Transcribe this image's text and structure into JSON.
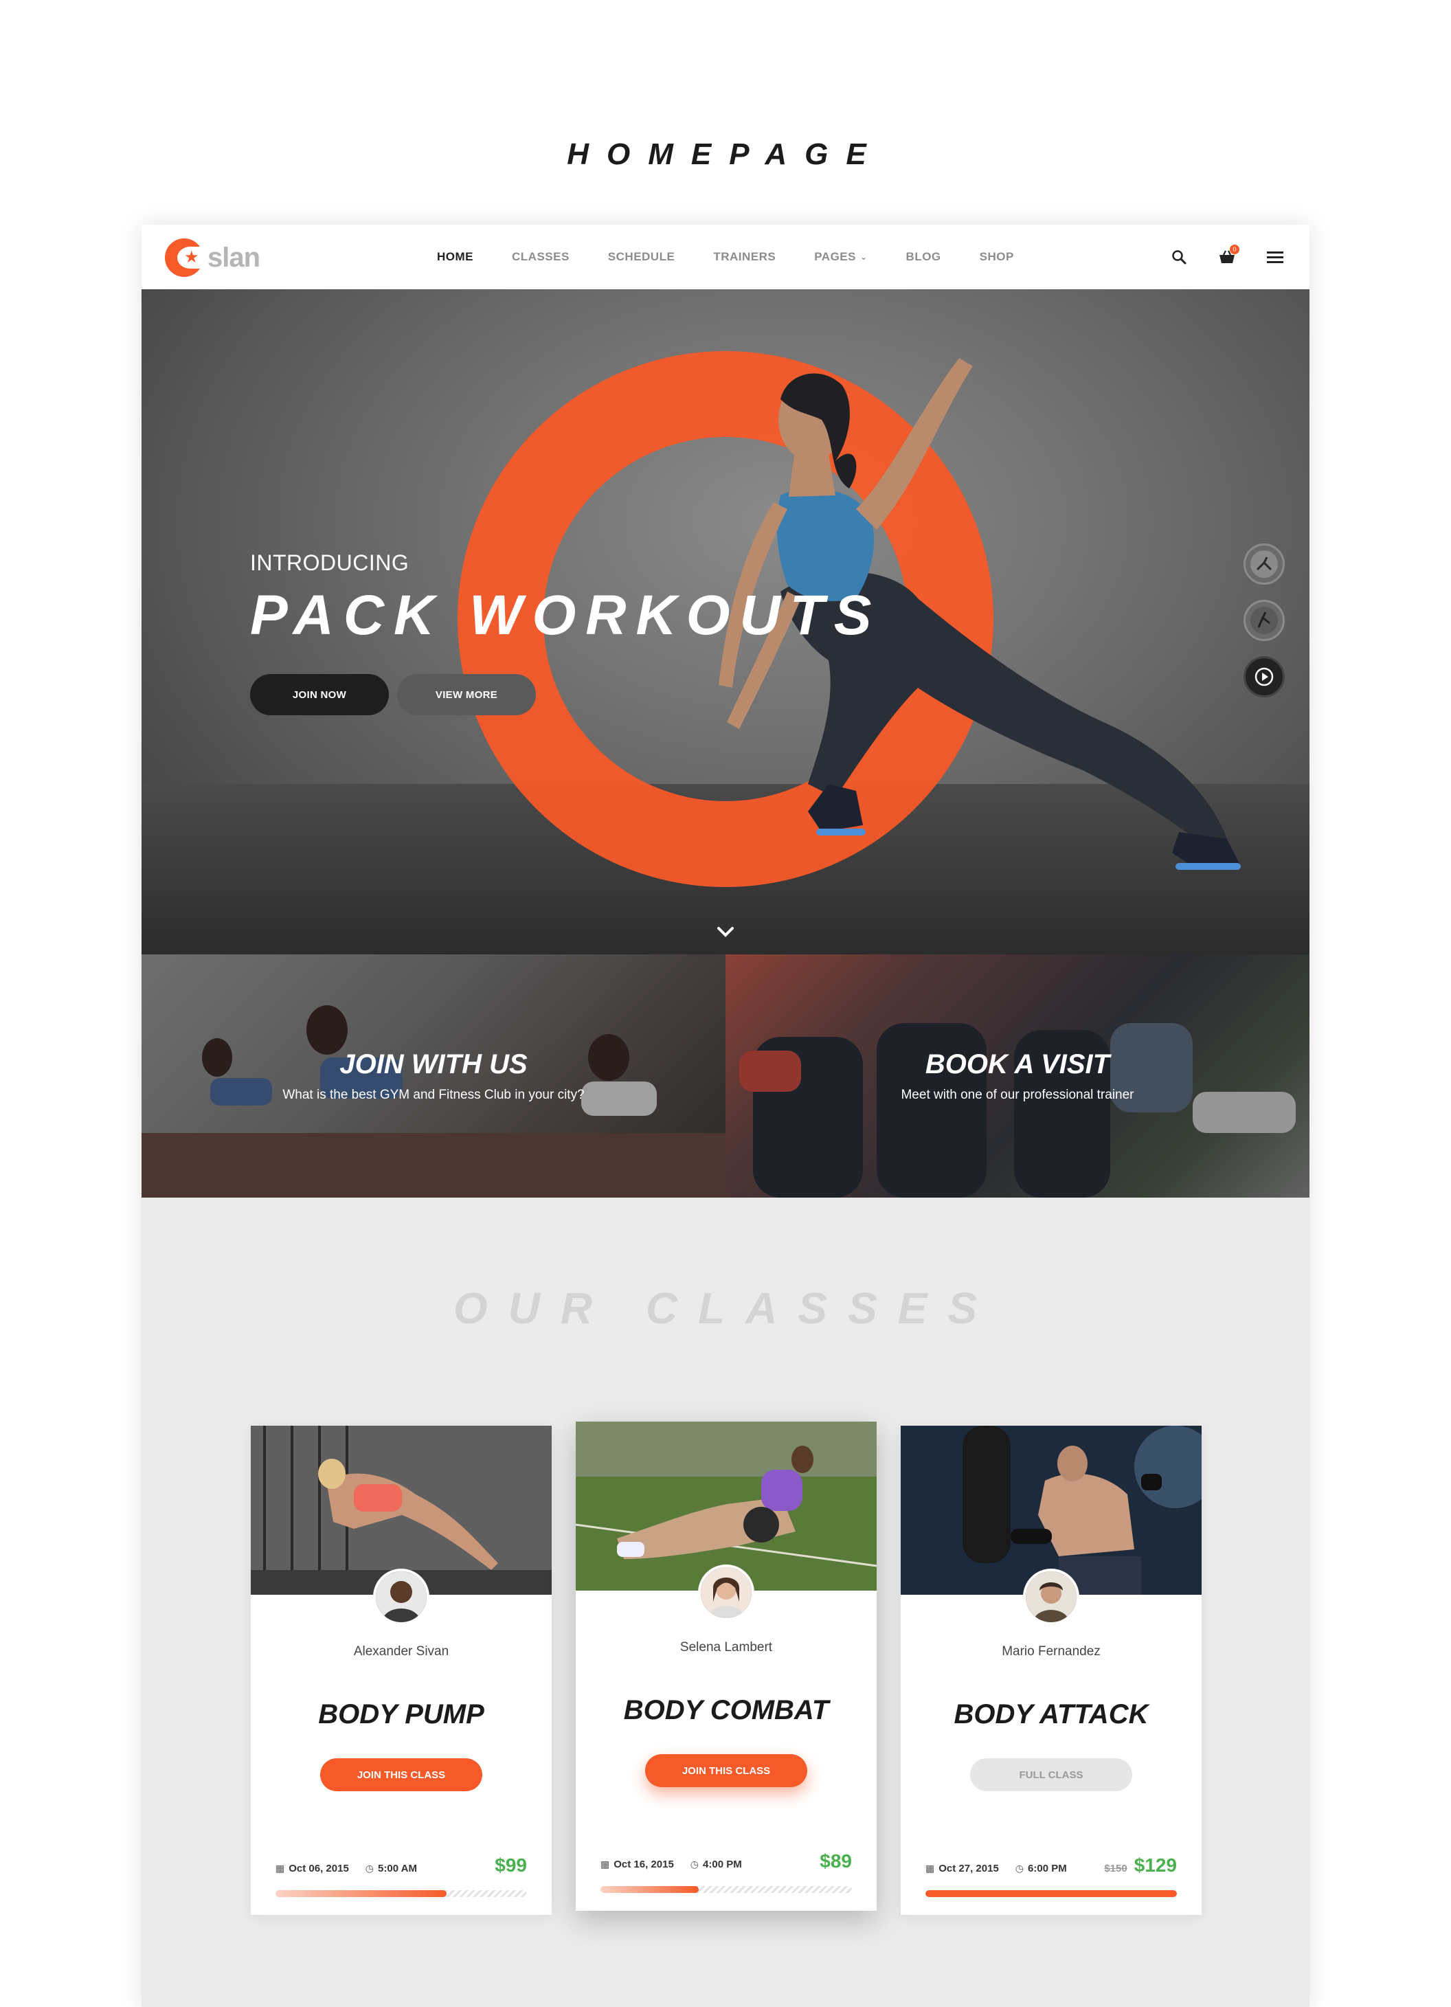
{
  "page_heading": "HOMEPAGE",
  "brand": {
    "logo_text": "slan",
    "accent": "#f55a28"
  },
  "nav": {
    "items": [
      "HOME",
      "CLASSES",
      "SCHEDULE",
      "TRAINERS",
      "PAGES",
      "BLOG",
      "SHOP"
    ],
    "active": "HOME",
    "icons": [
      "search-icon",
      "cart-icon",
      "menu-icon"
    ],
    "cart_count": "0"
  },
  "hero": {
    "intro": "INTRODUCING",
    "title": "PACK WORKOUTS",
    "join_button": "JOIN NOW",
    "more_button": "VIEW MORE"
  },
  "promos": [
    {
      "title": "JOIN WITH US",
      "subtitle": "What is the best GYM and Fitness Club in your city?"
    },
    {
      "title": "BOOK A VISIT",
      "subtitle": "Meet with one of our professional trainer"
    }
  ],
  "classes": {
    "title": "OUR CLASSES",
    "cards": [
      {
        "trainer": "Alexander Sivan",
        "name": "BODY PUMP",
        "button": "JOIN THIS CLASS",
        "date": "Oct 06, 2015",
        "time": "5:00 AM",
        "price": "$99",
        "old_price": "",
        "progress": 0.68,
        "full": false
      },
      {
        "trainer": "Selena Lambert",
        "name": "BODY COMBAT",
        "button": "JOIN THIS CLASS",
        "date": "Oct 16, 2015",
        "time": "4:00 PM",
        "price": "$89",
        "old_price": "",
        "progress": 0.39,
        "full": false
      },
      {
        "trainer": "Mario Fernandez",
        "name": "BODY ATTACK",
        "button": "FULL CLASS",
        "date": "Oct 27, 2015",
        "time": "6:00 PM",
        "price": "$129",
        "old_price": "$150",
        "progress": 1.0,
        "full": true
      }
    ]
  }
}
